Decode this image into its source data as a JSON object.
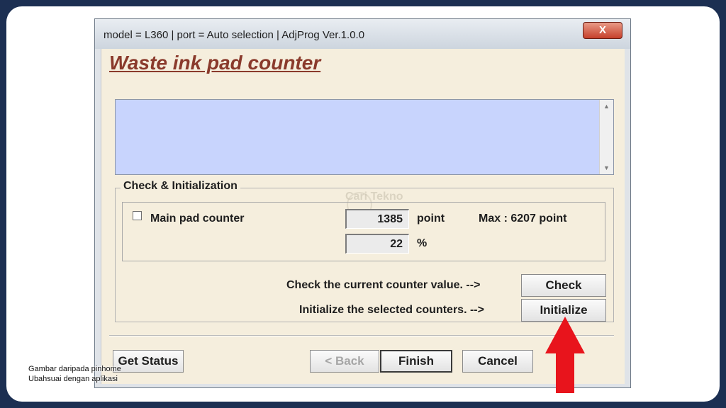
{
  "window": {
    "title": "model = L360 | port = Auto selection | AdjProg Ver.1.0.0",
    "close_label": "X"
  },
  "heading": "Waste ink pad counter",
  "group": {
    "legend": "Check & Initialization",
    "counter": {
      "label": "Main pad counter",
      "checked": false,
      "point_value": "1385",
      "point_unit": "point",
      "max_label": "Max : 6207 point",
      "percent_value": "22",
      "percent_unit": "%"
    },
    "check_instruction": "Check the current counter value. -->",
    "check_button": "Check",
    "init_instruction": "Initialize the selected counters. -->",
    "init_button": "Initialize"
  },
  "footer": {
    "get_status_button": "Get Status",
    "back_button": "< Back",
    "finish_button": "Finish",
    "cancel_button": "Cancel"
  },
  "watermark": "Cari Tekno",
  "caption": {
    "line1": "Gambar daripada pinhome",
    "line2": "Ubahsuai dengan aplikasi"
  },
  "colors": {
    "heading": "#8a3a2c",
    "log_background": "#c8d4fd",
    "client_background": "#f5eedd",
    "arrow": "#e8141c"
  },
  "icons": {
    "close": "close-icon",
    "scroll_up": "scroll-up-arrow-icon",
    "scroll_down": "scroll-down-arrow-icon",
    "annotation": "red-up-arrow-icon"
  }
}
